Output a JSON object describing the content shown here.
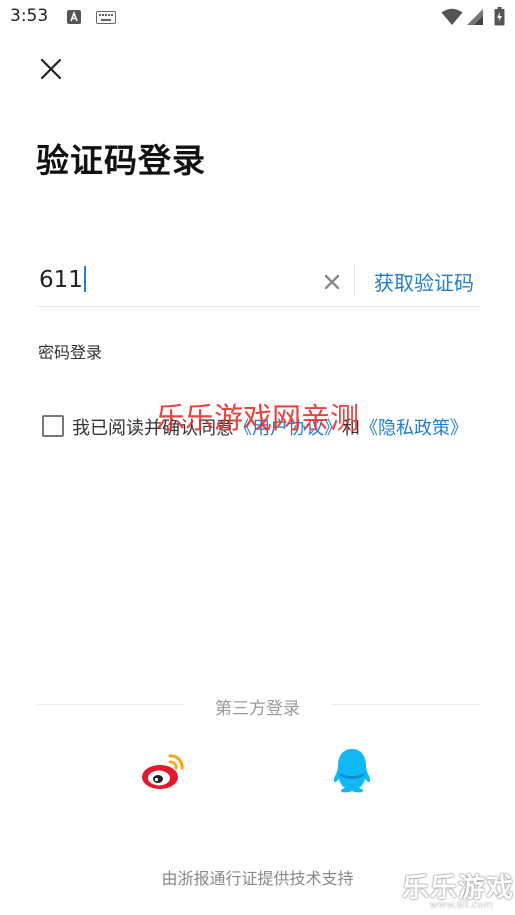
{
  "status_bar": {
    "time": "3:53",
    "icons": [
      "notification-a-icon",
      "keyboard-icon",
      "wifi-icon",
      "signal-icon",
      "battery-icon"
    ]
  },
  "header": {
    "close_icon": "close-icon",
    "title": "验证码登录"
  },
  "phone_input": {
    "value": "611",
    "clear_icon": "clear-icon",
    "get_code_label": "获取验证码"
  },
  "password_login_label": "密码登录",
  "agreement": {
    "checked": false,
    "prefix": "我已阅读并确认同意",
    "user_agreement": "《用户协议》",
    "and": "和",
    "privacy_policy": "《隐私政策》"
  },
  "watermark_text": "乐乐游戏网亲测",
  "third_party": {
    "label": "第三方登录",
    "providers": [
      {
        "icon": "weibo-icon"
      },
      {
        "icon": "qq-icon"
      }
    ]
  },
  "footer_text": "由浙报通行证提供技术支持",
  "brand_watermark": {
    "name": "乐乐游戏",
    "url": "www.6ll.com"
  },
  "colors": {
    "accent": "#1f7fd0",
    "watermark": "#e8342e",
    "weibo_red": "#e6162d",
    "weibo_orange": "#f5a623",
    "qq_blue": "#12b7f5"
  }
}
